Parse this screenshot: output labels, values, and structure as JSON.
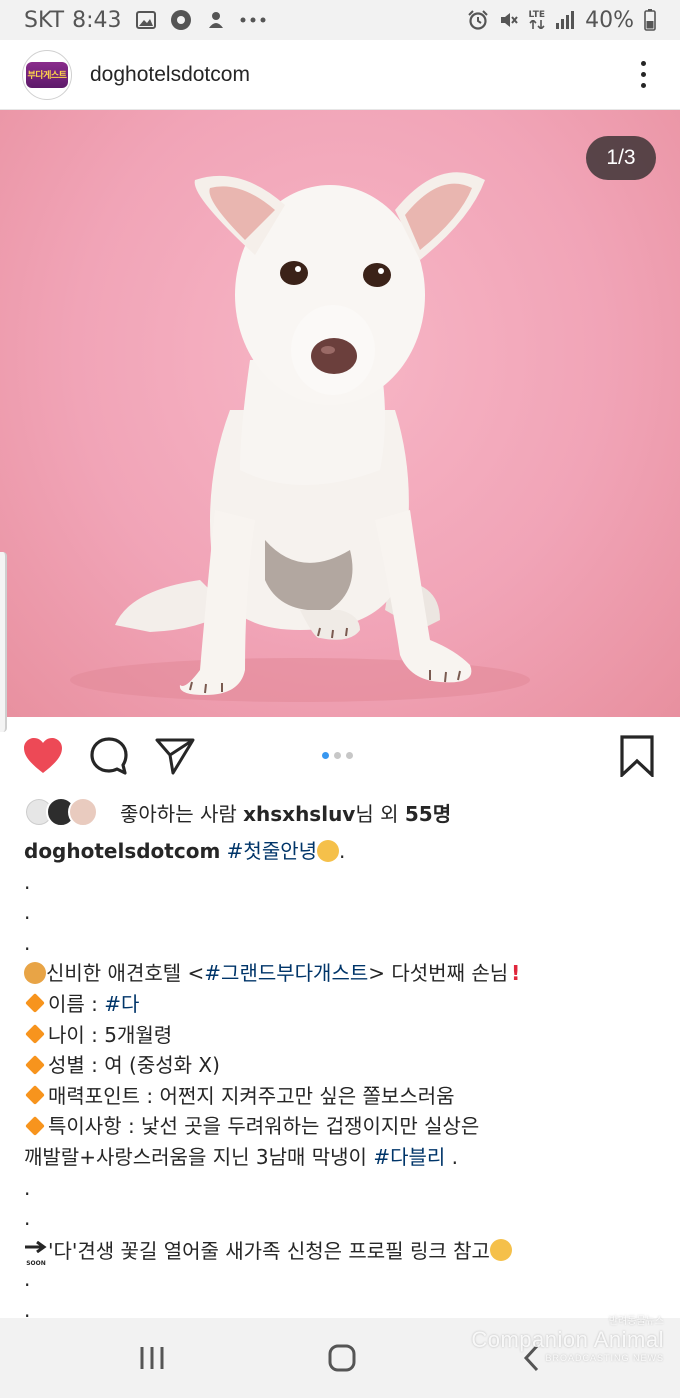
{
  "status_bar": {
    "carrier": "SKT",
    "time": "8:43",
    "network": "LTE",
    "battery": "40%",
    "left_icons": [
      "gallery-icon",
      "flower-icon",
      "upload-icon",
      "more-notifications-icon"
    ],
    "right_icons": [
      "alarm-icon",
      "mute-icon",
      "lte-icon",
      "signal-icon",
      "battery-icon"
    ]
  },
  "post": {
    "username": "doghotelsdotcom",
    "avatar_text": "부다게스트",
    "image_counter": "1/3",
    "carousel_total": 3,
    "carousel_active": 1,
    "liked": true,
    "likes": {
      "prefix": "좋아하는 사람 ",
      "user": "xhsxhsluv",
      "middle": "님 외 ",
      "count": "55명"
    },
    "caption": {
      "title_tag": "#첫줄안녕",
      "title_end": ".",
      "dot": ".",
      "intro_pre": "신비한 애견호텔 <",
      "intro_tag": "#그랜드부다개스트",
      "intro_post": "> 다섯번째 손님",
      "name_label": "이름 : ",
      "name_tag": "#다",
      "age": "나이 : 5개월령",
      "sex": "성별 : 여 (중성화 X)",
      "charm": "매력포인트 : 어쩐지 지켜주고만 싶은 쫄보스러움",
      "special1": "특이사항 : 낯선 곳을 두려워하는 겁쟁이지만 실상은",
      "special2_pre": "깨발랄+사랑스러움을 지닌 3남매 막냉이 ",
      "special2_tag": "#다블리",
      "special2_end": " .",
      "soon_label": "SOON",
      "adopt": "'다'견생 꽃길 열어줄 새가족 신청은 프로필 링크 참고"
    }
  },
  "watermark": {
    "small": "반려동물뉴스",
    "main": "Companion Animal",
    "sub": "BROADCASTING NEWS"
  },
  "colors": {
    "heart": "#ed4956",
    "hashtag": "#003569",
    "carousel_active": "#3897f0",
    "photo_bg": "#f1a4b7"
  }
}
